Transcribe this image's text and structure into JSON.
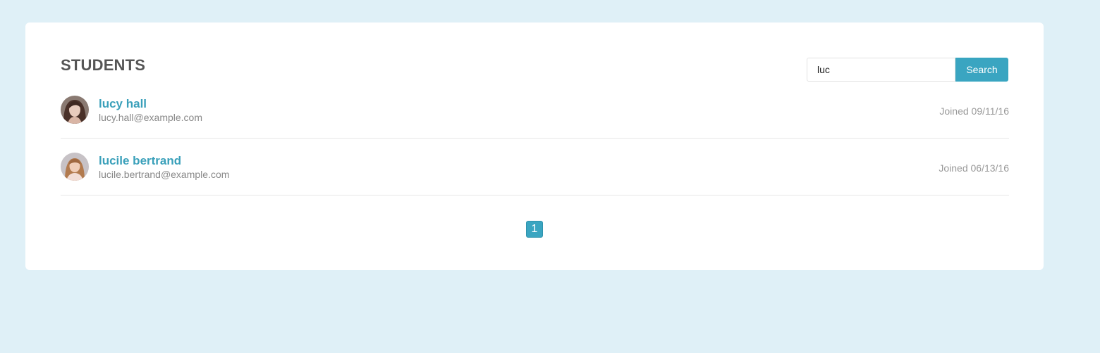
{
  "page": {
    "title": "STUDENTS"
  },
  "search": {
    "value": "luc",
    "button_label": "Search"
  },
  "students": [
    {
      "name": "lucy hall",
      "email": "lucy.hall@example.com",
      "joined": "Joined 09/11/16"
    },
    {
      "name": "lucile bertrand",
      "email": "lucile.bertrand@example.com",
      "joined": "Joined 06/13/16"
    }
  ],
  "pagination": {
    "current_page": "1"
  },
  "colors": {
    "background": "#dff0f7",
    "accent": "#3aa5c1",
    "link": "#3aa0ba"
  }
}
